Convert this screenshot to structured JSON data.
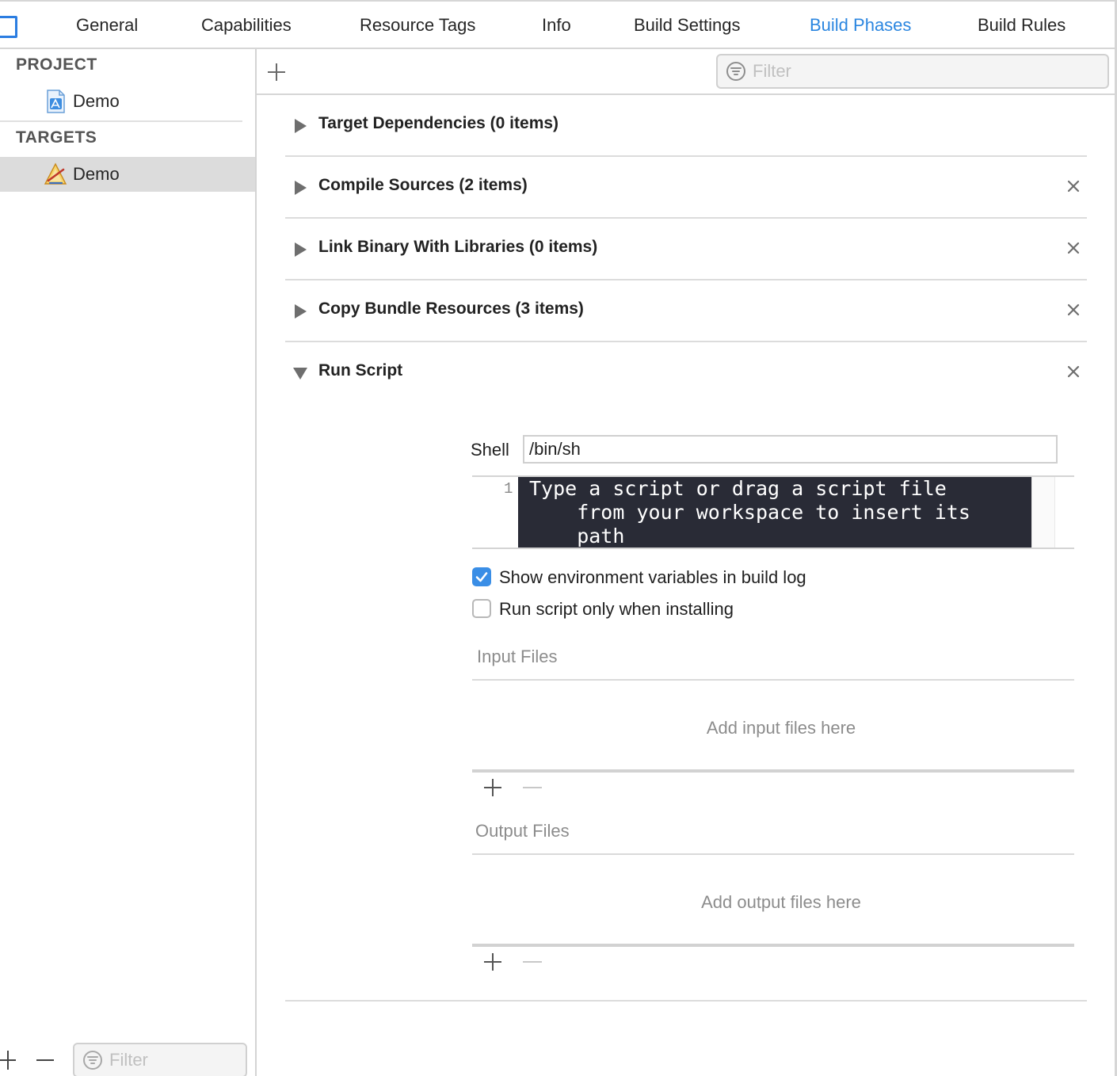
{
  "tabs": [
    {
      "label": "General",
      "active": false
    },
    {
      "label": "Capabilities",
      "active": false
    },
    {
      "label": "Resource Tags",
      "active": false
    },
    {
      "label": "Info",
      "active": false
    },
    {
      "label": "Build Settings",
      "active": false
    },
    {
      "label": "Build Phases",
      "active": true
    },
    {
      "label": "Build Rules",
      "active": false
    }
  ],
  "sidebar": {
    "project_header": "PROJECT",
    "project_item": "Demo",
    "targets_header": "TARGETS",
    "target_item": "Demo",
    "filter_placeholder": "Filter"
  },
  "main": {
    "filter_placeholder": "Filter",
    "phases": [
      {
        "title": "Target Dependencies (0 items)",
        "expanded": false,
        "removable": false
      },
      {
        "title": "Compile Sources (2 items)",
        "expanded": false,
        "removable": true
      },
      {
        "title": "Link Binary With Libraries (0 items)",
        "expanded": false,
        "removable": true
      },
      {
        "title": "Copy Bundle Resources (3 items)",
        "expanded": false,
        "removable": true
      },
      {
        "title": "Run Script",
        "expanded": true,
        "removable": true
      }
    ],
    "run_script": {
      "shell_label": "Shell",
      "shell_value": "/bin/sh",
      "line_number": "1",
      "script_text": "Type a script or drag a script file\n    from your workspace to insert its\n    path",
      "show_env_label": "Show environment variables in build log",
      "show_env_checked": true,
      "install_only_label": "Run script only when installing",
      "install_only_checked": false,
      "input_files_title": "Input Files",
      "input_files_empty": "Add input files here",
      "output_files_title": "Output Files",
      "output_files_empty": "Add output files here"
    }
  },
  "colors": {
    "accent": "#2b86e0",
    "checkbox_on": "#3a8ee6",
    "editor_bg": "#292b36"
  }
}
